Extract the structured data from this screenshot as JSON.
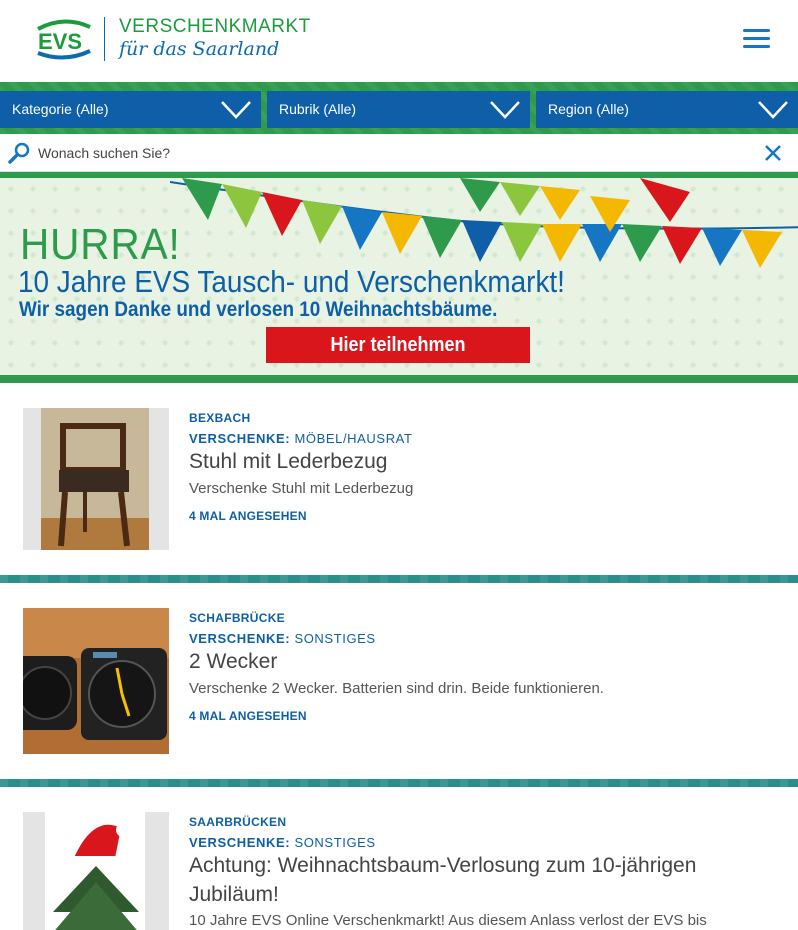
{
  "header": {
    "logo_line1": "VERSCHENKMARKT",
    "logo_line2": "für das Saarland",
    "logo_mark": "EVS",
    "menu_icon": "hamburger-menu-icon"
  },
  "filters": [
    {
      "label": "Kategorie (Alle)"
    },
    {
      "label": "Rubrik (Alle)"
    },
    {
      "label": "Region (Alle)"
    }
  ],
  "search": {
    "placeholder": "Wonach suchen Sie?",
    "value": "",
    "icon": "search-icon",
    "clear_icon": "close-icon"
  },
  "banner": {
    "headline": "HURRA!",
    "title": "10 Jahre EVS Tausch- und Verschenkmarkt!",
    "subtitle": "Wir sagen Danke und verlosen 10 Weihnachtsbäume.",
    "cta": "Hier teilnehmen"
  },
  "listings": [
    {
      "region": "BEXBACH",
      "type": "VERSCHENKE:",
      "category": "MÖBEL/HAUSRAT",
      "title": "Stuhl mit Lederbezug",
      "description": "Verschenke Stuhl mit Lederbezug",
      "views": "4 MAL ANGESEHEN"
    },
    {
      "region": "SCHAFBRÜCKE",
      "type": "VERSCHENKE:",
      "category": "SONSTIGES",
      "title": "2 Wecker",
      "description": "Verschenke 2 Wecker. Batterien sind drin. Beide funktionieren.",
      "views": "4 MAL ANGESEHEN"
    },
    {
      "region": "SAARBRÜCKEN",
      "type": "VERSCHENKE:",
      "category": "SONSTIGES",
      "title": "Achtung: Weihnachtsbaum-Verlosung zum 10-jährigen Jubiläum!",
      "description": "10 Jahre EVS Online Verschenkmarkt! Aus diesem Anlass verlost der EVS bis"
    }
  ],
  "colors": {
    "green": "#2d9a4c",
    "blue": "#0e5fa8",
    "red": "#d9161b",
    "teal": "#2a8f8a"
  }
}
